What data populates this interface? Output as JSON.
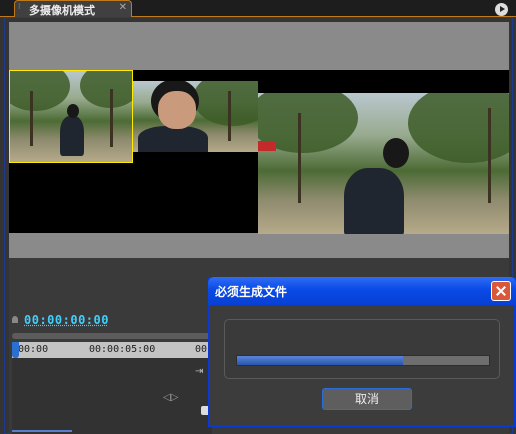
{
  "panel": {
    "tab_title": "多摄像机模式",
    "tab_close_glyph": "✕"
  },
  "controls": {
    "timecode": "00:00:00:00",
    "ruler_start": "00:00",
    "ruler_mid": "00:00:05:00",
    "ruler_next": "00"
  },
  "dialog": {
    "title": "必须生成文件",
    "progress": 0.66,
    "cancel_label": "取消"
  },
  "colors": {
    "accent_orange": "#c07a1a",
    "selected_cam_border": "#ffea00",
    "timecode": "#3fd0ff",
    "dialog_title_blue": "#0a4ae6",
    "progress_fill": "#2a55b0"
  },
  "icons": {
    "grip": "grip-icon",
    "close": "close-icon",
    "panel_menu": "panel-menu-icon",
    "step": "step-frame-icon",
    "rewind": "rewind-icon"
  }
}
